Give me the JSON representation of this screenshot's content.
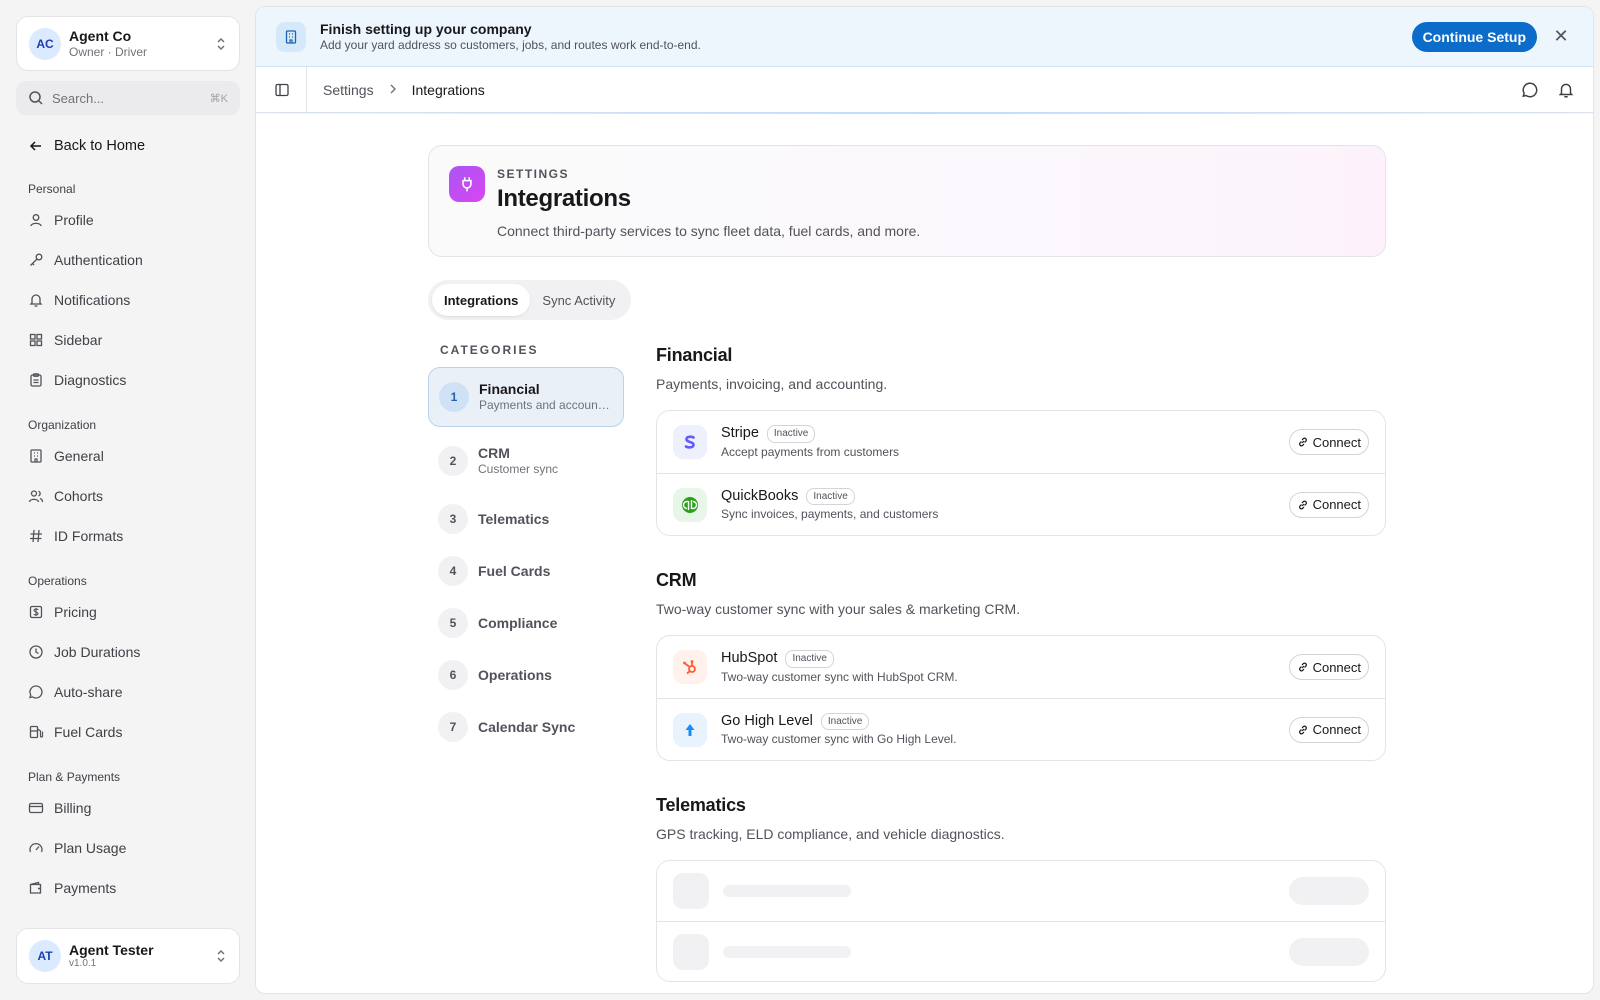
{
  "sidebar": {
    "org": {
      "initials": "AC",
      "name": "Agent Co",
      "role": "Owner · Driver"
    },
    "search": {
      "placeholder": "Search...",
      "shortcut": "⌘K"
    },
    "back_label": "Back to Home",
    "sections": [
      {
        "title": "Personal",
        "items": [
          {
            "label": "Profile",
            "icon": "user-icon"
          },
          {
            "label": "Authentication",
            "icon": "key-icon"
          },
          {
            "label": "Notifications",
            "icon": "bell-icon"
          },
          {
            "label": "Sidebar",
            "icon": "layout-grid-icon"
          },
          {
            "label": "Diagnostics",
            "icon": "clipboard-icon"
          }
        ]
      },
      {
        "title": "Organization",
        "items": [
          {
            "label": "General",
            "icon": "building-icon"
          },
          {
            "label": "Cohorts",
            "icon": "users-icon"
          },
          {
            "label": "ID Formats",
            "icon": "hash-icon"
          }
        ]
      },
      {
        "title": "Operations",
        "items": [
          {
            "label": "Pricing",
            "icon": "dollar-icon"
          },
          {
            "label": "Job Durations",
            "icon": "clock-icon"
          },
          {
            "label": "Auto-share",
            "icon": "message-icon"
          },
          {
            "label": "Fuel Cards",
            "icon": "fuel-icon"
          }
        ]
      },
      {
        "title": "Plan & Payments",
        "items": [
          {
            "label": "Billing",
            "icon": "credit-card-icon"
          },
          {
            "label": "Plan Usage",
            "icon": "gauge-icon"
          },
          {
            "label": "Payments",
            "icon": "wallet-icon"
          }
        ]
      }
    ],
    "user": {
      "initials": "AT",
      "name": "Agent Tester",
      "version": "v1.0.1"
    }
  },
  "banner": {
    "title": "Finish setting up your company",
    "subtitle": "Add your yard address so customers, jobs, and routes work end-to-end.",
    "cta": "Continue Setup",
    "close": "✕"
  },
  "breadcrumb": {
    "parent": "Settings",
    "current": "Integrations"
  },
  "hero": {
    "eyebrow": "SETTINGS",
    "title": "Integrations",
    "description": "Connect third-party services to sync fleet data, fuel cards, and more."
  },
  "tabs": [
    {
      "label": "Integrations",
      "active": true
    },
    {
      "label": "Sync Activity",
      "active": false
    }
  ],
  "categories": {
    "title": "CATEGORIES",
    "items": [
      {
        "num": "1",
        "name": "Financial",
        "sub": "Payments and accounting",
        "active": true
      },
      {
        "num": "2",
        "name": "CRM",
        "sub": "Customer sync",
        "active": false
      },
      {
        "num": "3",
        "name": "Telematics",
        "sub": "",
        "active": false
      },
      {
        "num": "4",
        "name": "Fuel Cards",
        "sub": "",
        "active": false
      },
      {
        "num": "5",
        "name": "Compliance",
        "sub": "",
        "active": false
      },
      {
        "num": "6",
        "name": "Operations",
        "sub": "",
        "active": false
      },
      {
        "num": "7",
        "name": "Calendar Sync",
        "sub": "",
        "active": false
      }
    ]
  },
  "sections": [
    {
      "title": "Financial",
      "description": "Payments, invoicing, and accounting.",
      "items": [
        {
          "name": "Stripe",
          "status": "Inactive",
          "description": "Accept payments from customers",
          "logo": "stripe-logo-icon",
          "connect": "Connect"
        },
        {
          "name": "QuickBooks",
          "status": "Inactive",
          "description": "Sync invoices, payments, and customers",
          "logo": "quickbooks-logo-icon",
          "connect": "Connect"
        }
      ]
    },
    {
      "title": "CRM",
      "description": "Two-way customer sync with your sales & marketing CRM.",
      "items": [
        {
          "name": "HubSpot",
          "status": "Inactive",
          "description": "Two-way customer sync with HubSpot CRM.",
          "logo": "hubspot-logo-icon",
          "connect": "Connect"
        },
        {
          "name": "Go High Level",
          "status": "Inactive",
          "description": "Two-way customer sync with Go High Level.",
          "logo": "gohighlevel-logo-icon",
          "connect": "Connect"
        }
      ]
    },
    {
      "title": "Telematics",
      "description": "GPS tracking, ELD compliance, and vehicle diagnostics.",
      "items": []
    }
  ],
  "colors": {
    "accent": "#0b6cc9",
    "active_category_bg": "#eaf0f7",
    "hero_icon": "#c04cf0"
  }
}
